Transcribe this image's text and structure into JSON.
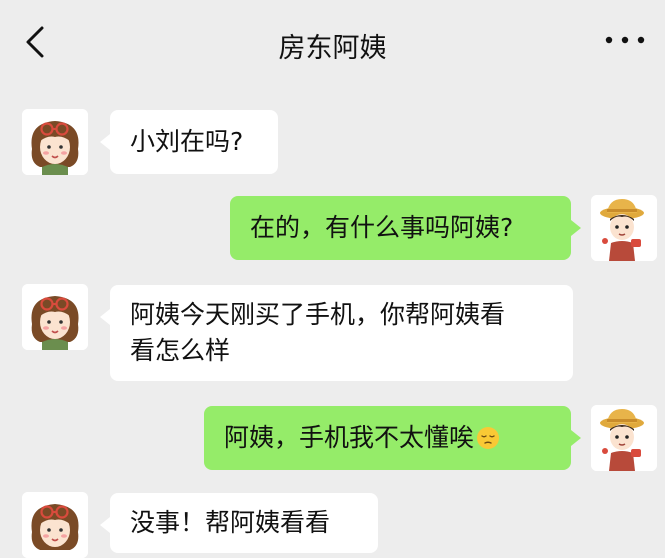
{
  "header": {
    "title": "房东阿姨",
    "back_icon": "chevron-left-icon",
    "more_icon": "more-dots-icon"
  },
  "messages": [
    {
      "sender": "房东阿姨",
      "side": "left",
      "text": "小刘在吗?"
    },
    {
      "sender": "me",
      "side": "right",
      "text": "在的，有什么事吗阿姨?"
    },
    {
      "sender": "房东阿姨",
      "side": "left",
      "text": "阿姨今天刚买了手机，你帮阿姨看\n看怎么样"
    },
    {
      "sender": "me",
      "side": "right",
      "text": "阿姨，手机我不太懂唉",
      "trailing_emoji": "pensive-face-emoji"
    },
    {
      "sender": "房东阿姨",
      "side": "left",
      "text": "没事！帮阿姨看看"
    }
  ],
  "colors": {
    "background": "#ededed",
    "incoming_bubble": "#ffffff",
    "outgoing_bubble": "#95ec69"
  },
  "avatars": {
    "landlady": "girl-with-red-glasses-avatar",
    "me": "boy-with-hat-avatar"
  }
}
